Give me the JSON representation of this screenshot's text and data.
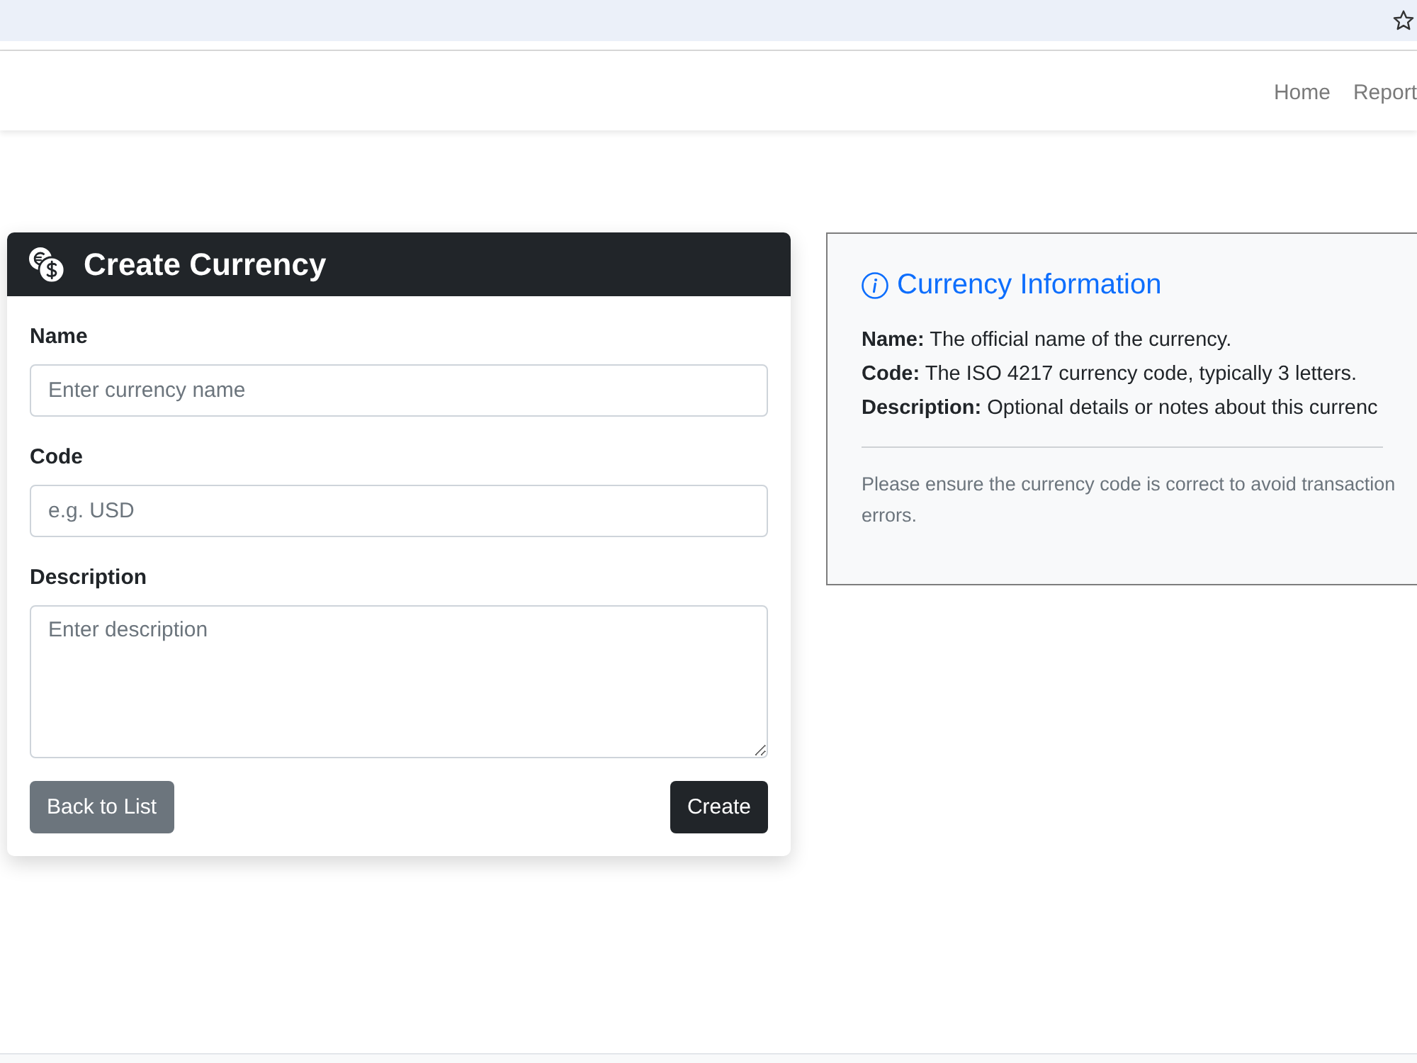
{
  "navbar": {
    "links": [
      "Home",
      "Report"
    ]
  },
  "form_card": {
    "title": "Create Currency",
    "fields": [
      {
        "kind": "input",
        "label": "Name",
        "placeholder": "Enter currency name"
      },
      {
        "kind": "input",
        "label": "Code",
        "placeholder": "e.g. USD"
      },
      {
        "kind": "textarea",
        "label": "Description",
        "placeholder": "Enter description"
      }
    ],
    "buttons": [
      {
        "kind": "secondary",
        "label": "Back to List"
      },
      {
        "kind": "primary",
        "label": "Create"
      }
    ]
  },
  "info_panel": {
    "title": "Currency Information",
    "definitions": [
      "**Name:** The official name of the currency.",
      "**Code:** The ISO 4217 currency code, typically 3 letters.",
      "**Description:** Optional details or notes about this currenc"
    ],
    "note": "Please ensure the currency code is correct to avoid transaction errors."
  }
}
